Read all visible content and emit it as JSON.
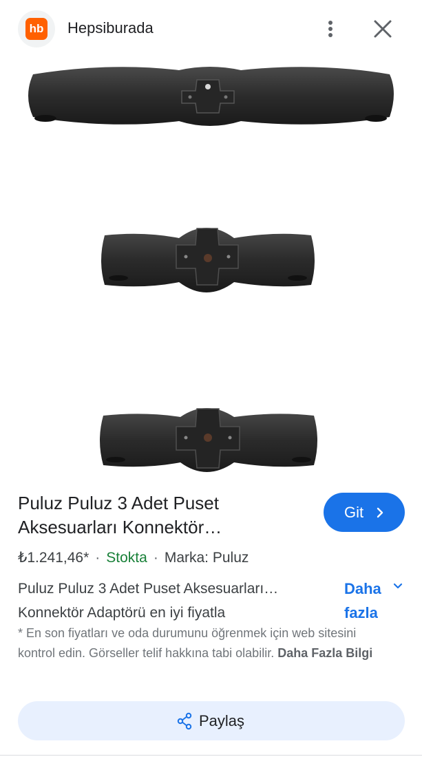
{
  "header": {
    "logo_text": "hb",
    "logo_color": "#ff6000",
    "site_name": "Hepsiburada",
    "icons": [
      "more-vert-icon",
      "close-icon"
    ]
  },
  "product": {
    "title": "Puluz Puluz 3 Adet Puset Aksesuarları Konnektör…",
    "go_button_label": "Git",
    "price": "₺1.241,46*",
    "stock": "Stokta",
    "brand": "Marka: Puluz",
    "description": "Puluz Puluz 3 Adet Puset Aksesuarları… Konnektör Adaptörü en iyi fiyatla",
    "more_label": "Daha fazla",
    "disclaimer_text": "* En son fiyatları ve oda durumunu öğrenmek için web sitesini kontrol edin. Görseller telif hakkına tabi olabilir.",
    "disclaimer_link": "Daha Fazla Bilgi",
    "share_label": "Paylaş"
  },
  "colors": {
    "accent": "#1a73e8",
    "stock_green": "#188038",
    "share_bg": "#e8f0fe"
  }
}
